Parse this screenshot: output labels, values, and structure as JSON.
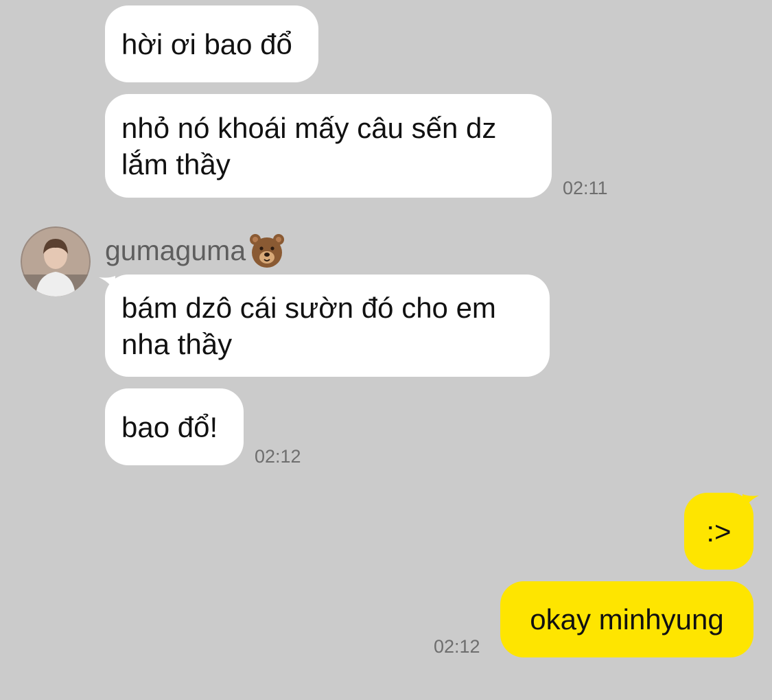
{
  "messages_top": {
    "msg1": "hời ơi bao đổ",
    "msg2_line1": "nhỏ nó khoái mấy câu sến dz",
    "msg2_line2": "lắm thầy",
    "time1": "02:11"
  },
  "sender": {
    "name": "gumaguma",
    "emoji_icon": "bear-face-icon"
  },
  "messages_mid": {
    "msg3_line1": "bám dzô cái sườn đó cho em",
    "msg3_line2": "nha thầy",
    "msg4": "bao đổ!",
    "time2": "02:12"
  },
  "messages_out": {
    "msg5": ":>",
    "msg6": "okay minhyung",
    "time3": "02:12"
  },
  "colors": {
    "background": "#cbcbcb",
    "incoming_bubble": "#ffffff",
    "outgoing_bubble": "#fee500",
    "timestamp": "#6e6e6e"
  }
}
